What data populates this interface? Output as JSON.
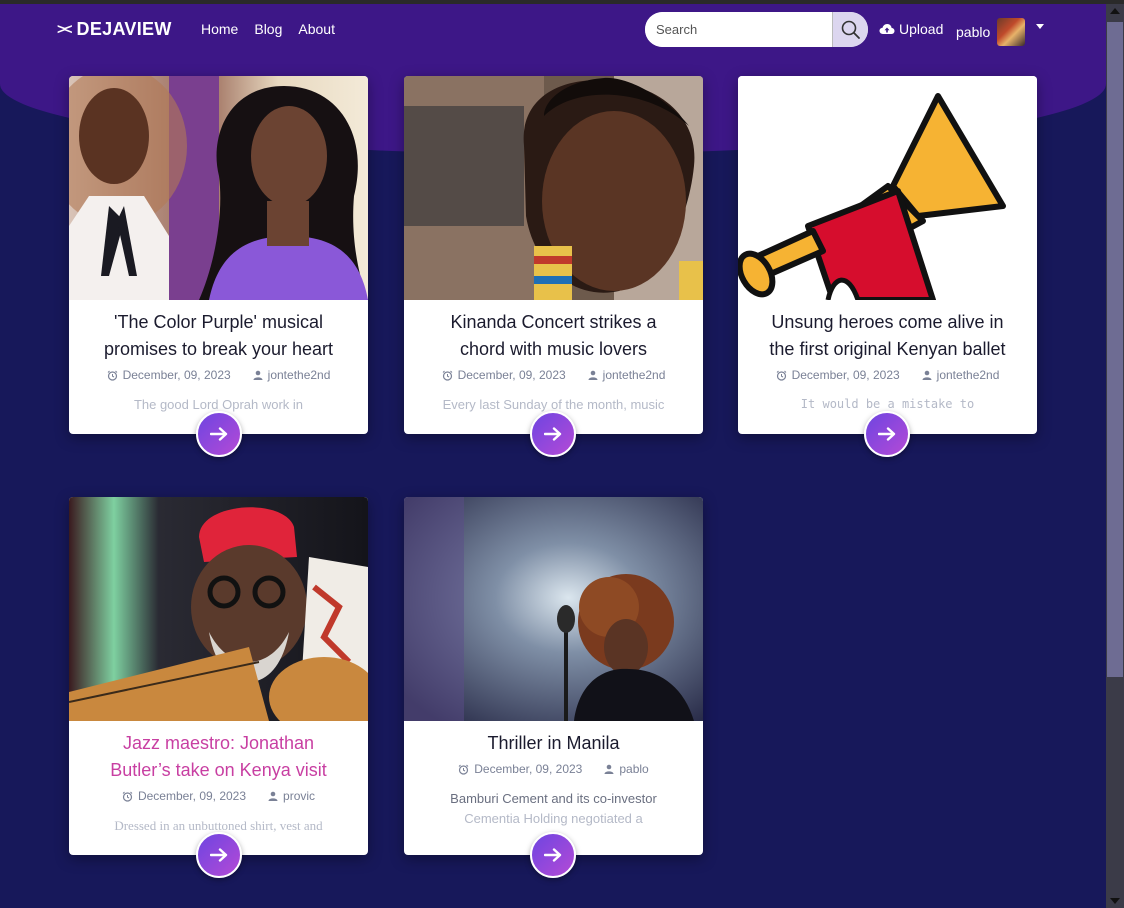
{
  "brand": {
    "name": "DEJAVIEW",
    "mark": "><"
  },
  "nav": {
    "links": [
      "Home",
      "Blog",
      "About"
    ]
  },
  "search": {
    "placeholder": "Search"
  },
  "upload": {
    "label": "Upload"
  },
  "user": {
    "name": "pablo"
  },
  "colors": {
    "header": "#3d1787",
    "page": "#17185a",
    "accent_pink": "#c83fa2",
    "button_start": "#6e45e1",
    "button_end": "#b44ad6"
  },
  "cards": [
    {
      "title": "'The Color Purple' musical promises to break your heart",
      "date": "December, 09, 2023",
      "author": "jontethe2nd",
      "excerpt": "The good Lord Oprah work in",
      "image": "portrait-two-women-photo"
    },
    {
      "title": "Kinanda Concert strikes a chord with music lovers",
      "date": "December, 09, 2023",
      "author": "jontethe2nd",
      "excerpt": "Every last Sunday of the month, music",
      "image": "portrait-woman-photo"
    },
    {
      "title": "Unsung heroes come alive in the first original Kenyan ballet",
      "date": "December, 09, 2023",
      "author": "jontethe2nd",
      "excerpt": "It would be a mistake to",
      "image": "trumpet-illustration"
    },
    {
      "title": "Jazz maestro: Jonathan Butler’s take on Kenya visit",
      "date": "December, 09, 2023",
      "author": "provic",
      "excerpt": "Dressed in an unbuttoned shirt, vest and",
      "image": "guitarist-photo"
    },
    {
      "title": "Thriller in Manila",
      "date": "December, 09, 2023",
      "author": "pablo",
      "excerpt": "Bamburi Cement and its co-investor",
      "excerpt2": "Cementia Holding negotiated a",
      "image": "singer-photo"
    }
  ]
}
